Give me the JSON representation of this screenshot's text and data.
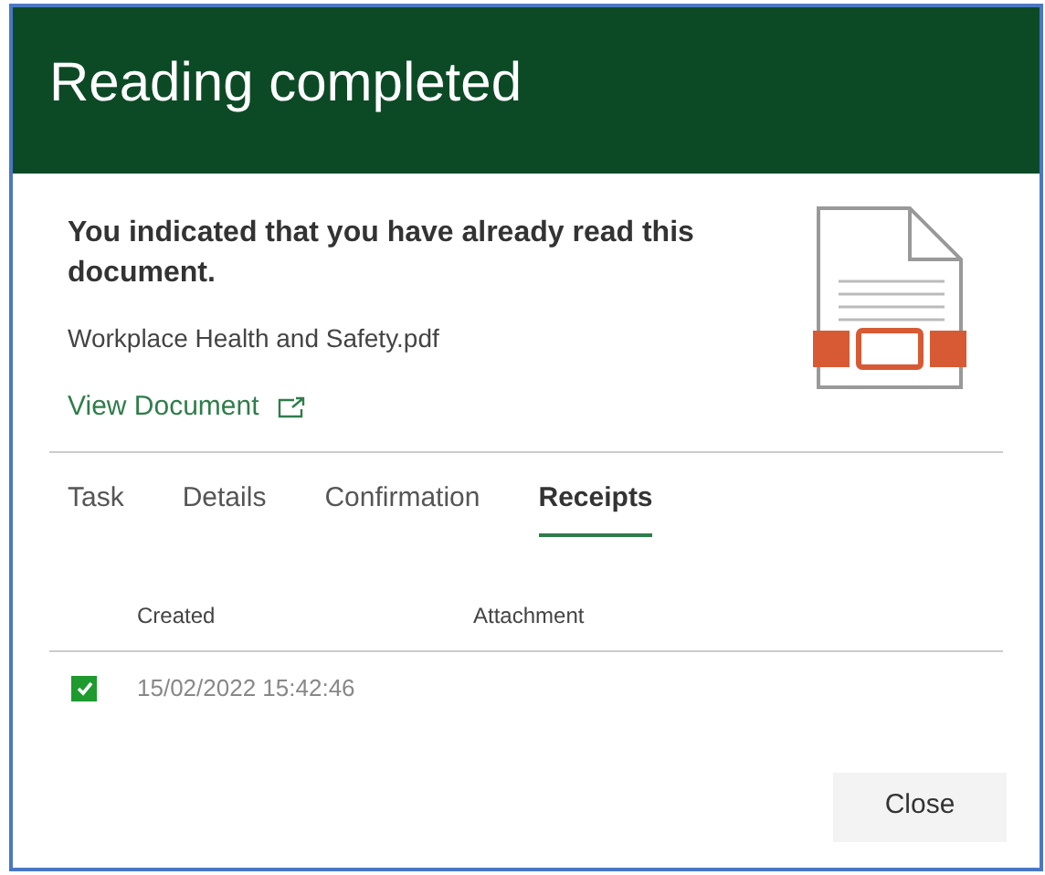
{
  "dialog": {
    "title": "Reading completed"
  },
  "message": "You indicated that you have already read this document.",
  "file_name": "Workplace Health and Safety.pdf",
  "view_link": "View Document",
  "tabs": [
    {
      "label": "Task",
      "selected": false
    },
    {
      "label": "Details",
      "selected": false
    },
    {
      "label": "Confirmation",
      "selected": false
    },
    {
      "label": "Receipts",
      "selected": true
    }
  ],
  "table": {
    "columns": [
      "Created",
      "Attachment"
    ],
    "rows": [
      {
        "checked": true,
        "created": "15/02/2022 15:42:46"
      }
    ]
  },
  "buttons": [
    "Close"
  ]
}
